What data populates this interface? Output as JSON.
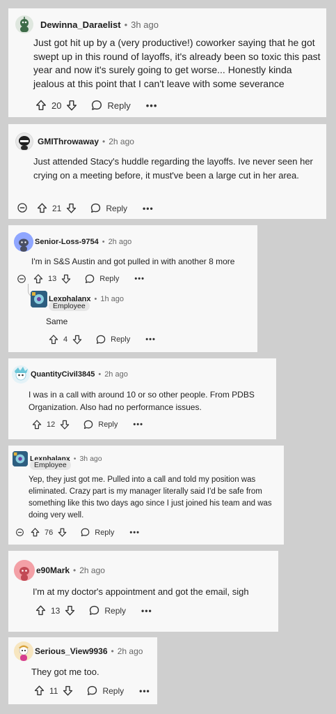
{
  "comments": [
    {
      "username": "Dewinna_Daraelist",
      "time": "3h ago",
      "text": "Just got hit up by a (very productive!) coworker saying that he got swept up in this round of layoffs, it's already been so toxic this past year and now it's surely going to get worse... Honestly kinda jealous at this point that I can't leave with some severance",
      "votes": "20",
      "reply": "Reply"
    },
    {
      "username": "GMIThrowaway",
      "time": "2h ago",
      "text": "Just attended Stacy's huddle regarding the layoffs. Ive never seen her crying on a meeting before, it must've been a large cut in her area.",
      "votes": "21",
      "reply": "Reply"
    },
    {
      "username": "Senior-Loss-9754",
      "time": "2h ago",
      "text": "I'm in S&S Austin and got pulled in with another 8 more",
      "votes": "13",
      "reply": "Reply",
      "child": {
        "username": "Lexphalanx",
        "time": "1h ago",
        "badge": "Employee",
        "text": "Same",
        "votes": "4",
        "reply": "Reply"
      }
    },
    {
      "username": "QuantityCivil3845",
      "time": "2h ago",
      "text": "I was in a call with around 10 or so other people. From PDBS Organization. Also had no performance issues.",
      "votes": "12",
      "reply": "Reply"
    },
    {
      "username": "Lexphalanx",
      "time": "3h ago",
      "badge": "Employee",
      "text": "Yep, they just got me. Pulled into a call and told my position was eliminated. Crazy part is my manager literally said I'd be safe from something like this two days ago since I just joined his team and was doing very well.",
      "votes": "76",
      "reply": "Reply"
    },
    {
      "username": "e90Mark",
      "time": "2h ago",
      "text": "I'm at my doctor's appointment and got the email, sigh",
      "votes": "13",
      "reply": "Reply"
    },
    {
      "username": "Serious_View9936",
      "time": "2h ago",
      "text": "They got me too.",
      "votes": "11",
      "reply": "Reply"
    }
  ],
  "separator": "•",
  "more": "•••",
  "colors": {
    "background": "#cfcfcf",
    "card": "#f8f8f8",
    "badge": "#e6e6e6"
  },
  "icons": [
    "upvote-icon",
    "downvote-icon",
    "comment-icon",
    "more-icon",
    "collapse-icon",
    "avatar"
  ]
}
